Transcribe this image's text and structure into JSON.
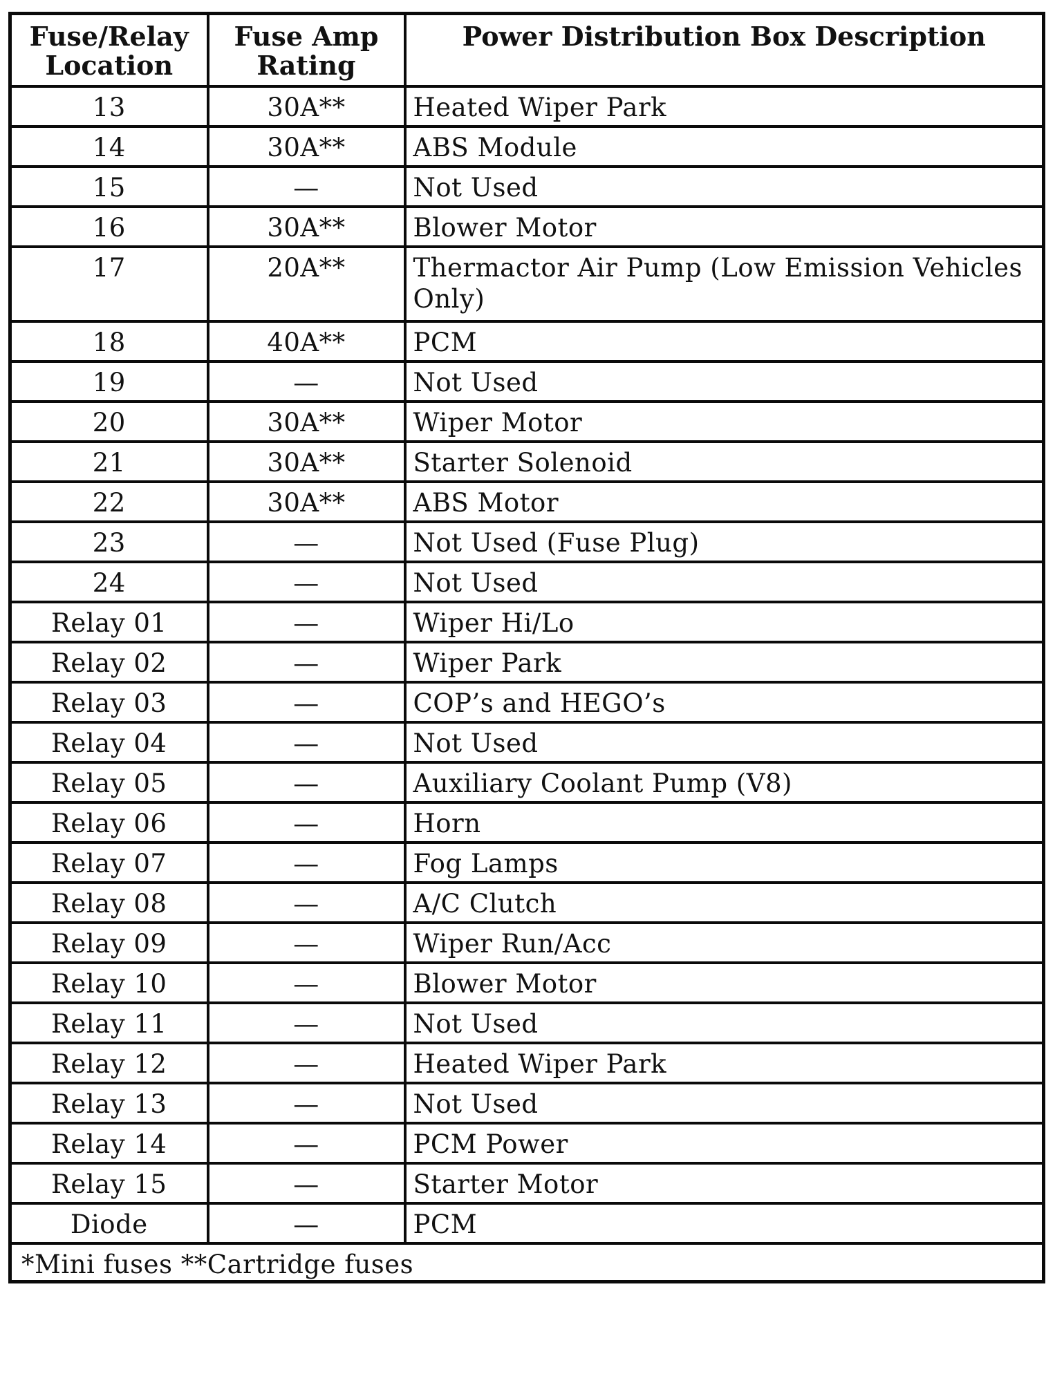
{
  "table": {
    "headers": {
      "location": "Fuse/Relay Location",
      "location_line1": "Fuse/Relay",
      "location_line2": "Location",
      "rating": "Fuse Amp Rating",
      "rating_line1": "Fuse Amp",
      "rating_line2": "Rating",
      "description": "Power Distribution Box Description"
    },
    "rows": [
      {
        "location": "13",
        "rating": "30A**",
        "description": "Heated Wiper Park"
      },
      {
        "location": "14",
        "rating": "30A**",
        "description": "ABS Module"
      },
      {
        "location": "15",
        "rating": "—",
        "description": "Not Used"
      },
      {
        "location": "16",
        "rating": "30A**",
        "description": "Blower Motor"
      },
      {
        "location": "17",
        "rating": "20A**",
        "description": "Thermactor Air Pump (Low Emission Vehicles Only)"
      },
      {
        "location": "18",
        "rating": "40A**",
        "description": "PCM"
      },
      {
        "location": "19",
        "rating": "—",
        "description": "Not Used"
      },
      {
        "location": "20",
        "rating": "30A**",
        "description": "Wiper Motor"
      },
      {
        "location": "21",
        "rating": "30A**",
        "description": "Starter Solenoid"
      },
      {
        "location": "22",
        "rating": "30A**",
        "description": "ABS Motor"
      },
      {
        "location": "23",
        "rating": "—",
        "description": "Not Used (Fuse Plug)"
      },
      {
        "location": "24",
        "rating": "—",
        "description": "Not Used"
      },
      {
        "location": "Relay 01",
        "rating": "—",
        "description": "Wiper Hi/Lo"
      },
      {
        "location": "Relay 02",
        "rating": "—",
        "description": "Wiper Park"
      },
      {
        "location": "Relay 03",
        "rating": "—",
        "description": "COP’s and HEGO’s"
      },
      {
        "location": "Relay 04",
        "rating": "—",
        "description": "Not Used"
      },
      {
        "location": "Relay 05",
        "rating": "—",
        "description": "Auxiliary Coolant Pump (V8)"
      },
      {
        "location": "Relay 06",
        "rating": "—",
        "description": "Horn"
      },
      {
        "location": "Relay 07",
        "rating": "—",
        "description": "Fog Lamps"
      },
      {
        "location": "Relay 08",
        "rating": "—",
        "description": "A/C Clutch"
      },
      {
        "location": "Relay 09",
        "rating": "—",
        "description": "Wiper Run/Acc"
      },
      {
        "location": "Relay 10",
        "rating": "—",
        "description": "Blower Motor"
      },
      {
        "location": "Relay 11",
        "rating": "—",
        "description": "Not Used"
      },
      {
        "location": "Relay 12",
        "rating": "—",
        "description": "Heated Wiper Park"
      },
      {
        "location": "Relay 13",
        "rating": "—",
        "description": "Not Used"
      },
      {
        "location": "Relay 14",
        "rating": "—",
        "description": "PCM Power"
      },
      {
        "location": "Relay 15",
        "rating": "—",
        "description": "Starter Motor"
      },
      {
        "location": "Diode",
        "rating": "—",
        "description": "PCM"
      }
    ],
    "footnote": "*Mini fuses **Cartridge fuses"
  }
}
